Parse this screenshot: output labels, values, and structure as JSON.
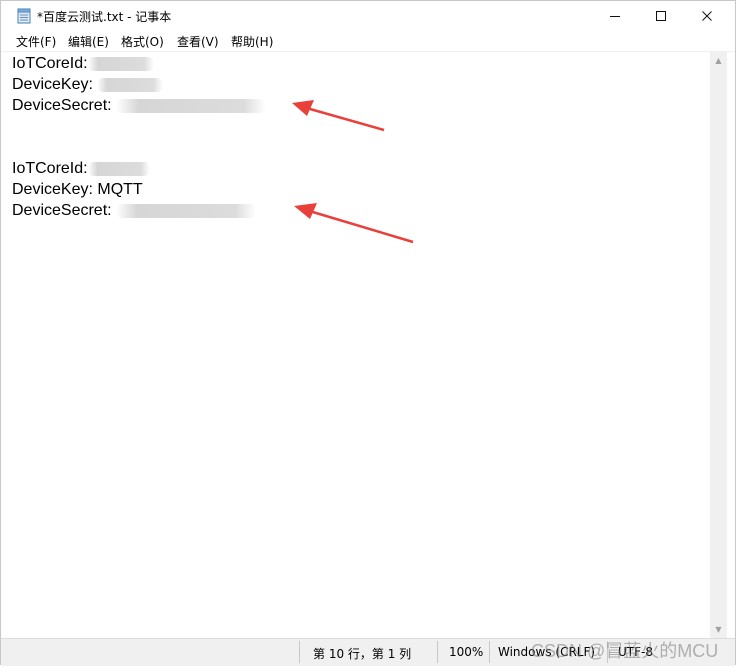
{
  "window": {
    "title": "*百度云测试.txt - 记事本",
    "controls": {
      "minimize": "—",
      "maximize": "☐",
      "close": "✕"
    }
  },
  "menu": {
    "items": [
      "文件(F)",
      "编辑(E)",
      "格式(O)",
      "查看(V)",
      "帮助(H)"
    ]
  },
  "editor": {
    "lines": [
      {
        "label": "IoTCoreId:",
        "value_redacted": true
      },
      {
        "label": "DeviceKey:",
        "value_redacted": true
      },
      {
        "label": "DeviceSecret:",
        "value_redacted": true
      },
      {
        "label": "",
        "value_redacted": false
      },
      {
        "label": "IoTCoreId:",
        "value_redacted": true
      },
      {
        "label": "DeviceKey:",
        "value": "MQTT"
      },
      {
        "label": "DeviceSecret:",
        "value_redacted": true
      }
    ]
  },
  "statusbar": {
    "position": "第 10 行，第 1 列",
    "zoom": "100%",
    "line_ending": "Windows (CRLF)",
    "encoding": "UTF-8"
  },
  "watermark": "CSDN @冒蓝火的MCU",
  "colors": {
    "annotation_arrow": "#e8413b",
    "statusbar_bg": "#f0f0f0"
  },
  "icons": {
    "app": "notepad-icon"
  }
}
